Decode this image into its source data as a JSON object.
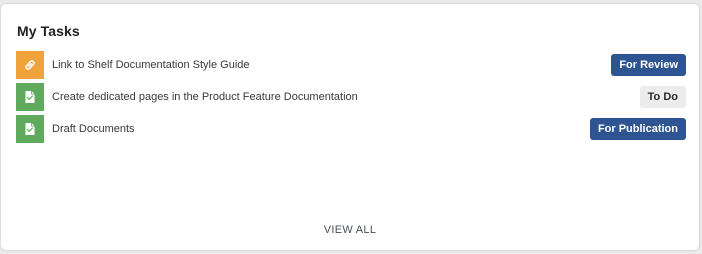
{
  "widget": {
    "title": "My Tasks",
    "view_all_label": "VIEW ALL"
  },
  "tasks": [
    {
      "label": "Link to Shelf Documentation Style Guide",
      "icon": "link-icon",
      "icon_color": "#f0a33a",
      "status": "For Review",
      "status_bg": "#2e5592",
      "status_fg": "#ffffff"
    },
    {
      "label": "Create dedicated pages in the Product Feature Documentation",
      "icon": "document-icon",
      "icon_color": "#5faa5c",
      "status": "To Do",
      "status_bg": "#ececec",
      "status_fg": "#2a2a2a"
    },
    {
      "label": "Draft Documents",
      "icon": "document-icon",
      "icon_color": "#5faa5c",
      "status": "For Publication",
      "status_bg": "#2e5592",
      "status_fg": "#ffffff"
    }
  ]
}
